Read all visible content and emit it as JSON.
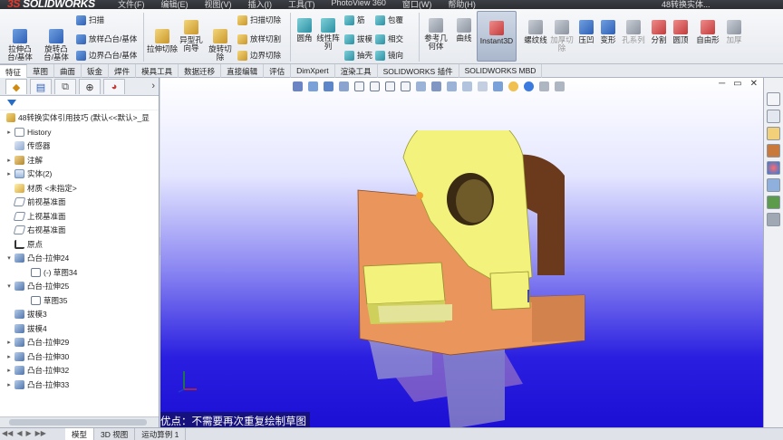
{
  "app": {
    "logo_prefix": "3S",
    "logo_text": "SOLIDWORKS",
    "menus": [
      "文件(F)",
      "编辑(E)",
      "视图(V)",
      "插入(I)",
      "工具(T)",
      "PhotoView 360",
      "窗口(W)",
      "帮助(H)"
    ],
    "document_title": "48转换实体..."
  },
  "ribbon": {
    "extrude_boss": "拉伸凸台/基体",
    "revolve_boss": "旋转凸台/基体",
    "sweep": "扫描",
    "loft": "放样凸台/基体",
    "boundary_boss": "边界凸台/基体",
    "extruded_cut": "拉伸切除",
    "hole_wizard": "异型孔向导",
    "revolved_cut": "旋转切除",
    "swept_cut": "扫描切除",
    "lofted_cut": "放样切割",
    "boundary_cut": "边界切除",
    "fillet": "圆角",
    "linear_pattern": "线性阵列",
    "rib": "筋",
    "draft": "拔模",
    "shell": "抽壳",
    "wrap": "包覆",
    "intersect": "相交",
    "mirror": "镜向",
    "ref_geometry": "参考几何体",
    "curves": "曲线",
    "instant3d": "Instant3D",
    "thread": "螺纹线",
    "thicken_cut": "加厚切除",
    "indent": "压凹",
    "flex": "变形",
    "dome": "圆顶",
    "split": "分割",
    "freeform": "自由形",
    "thicken": "加厚",
    "shape": "孔系列"
  },
  "command_tabs": [
    "特征",
    "草图",
    "曲面",
    "钣金",
    "焊件",
    "模具工具",
    "数据迁移",
    "直接编辑",
    "评估",
    "DimXpert",
    "渲染工具",
    "SOLIDWORKS 插件",
    "SOLIDWORKS MBD"
  ],
  "feature_tree": {
    "root": "48转换实体引用技巧 (默认<<默认>_显",
    "items": [
      {
        "label": "History",
        "icon": "history-icon",
        "expand": "▸",
        "depth": 0
      },
      {
        "label": "传感器",
        "icon": "sensor-icon",
        "expand": "",
        "depth": 0
      },
      {
        "label": "注解",
        "icon": "annotations-icon",
        "expand": "▸",
        "depth": 0
      },
      {
        "label": "实体(2)",
        "icon": "solid-bodies-icon",
        "expand": "▸",
        "depth": 0
      },
      {
        "label": "材质 <未指定>",
        "icon": "material-icon",
        "expand": "",
        "depth": 0
      },
      {
        "label": "前视基准面",
        "icon": "plane-icon",
        "expand": "",
        "depth": 0
      },
      {
        "label": "上视基准面",
        "icon": "plane-icon",
        "expand": "",
        "depth": 0
      },
      {
        "label": "右视基准面",
        "icon": "plane-icon",
        "expand": "",
        "depth": 0
      },
      {
        "label": "原点",
        "icon": "origin-icon",
        "expand": "",
        "depth": 0
      },
      {
        "label": "凸台-拉伸24",
        "icon": "extrude-feature-icon",
        "expand": "▾",
        "depth": 0
      },
      {
        "label": "(-) 草图34",
        "icon": "sketch-icon",
        "expand": "",
        "depth": 1
      },
      {
        "label": "凸台-拉伸25",
        "icon": "extrude-feature-icon",
        "expand": "▾",
        "depth": 0
      },
      {
        "label": "草图35",
        "icon": "sketch-icon",
        "expand": "",
        "depth": 1
      },
      {
        "label": "拔模3",
        "icon": "draft-feature-icon",
        "expand": "",
        "depth": 0
      },
      {
        "label": "拔模4",
        "icon": "draft-feature-icon",
        "expand": "",
        "depth": 0
      },
      {
        "label": "凸台-拉伸29",
        "icon": "extrude-feature-icon",
        "expand": "▸",
        "depth": 0
      },
      {
        "label": "凸台-拉伸30",
        "icon": "extrude-feature-icon",
        "expand": "▸",
        "depth": 0
      },
      {
        "label": "凸台-拉伸32",
        "icon": "extrude-feature-icon",
        "expand": "▸",
        "depth": 0
      },
      {
        "label": "凸台-拉伸33",
        "icon": "extrude-feature-icon",
        "expand": "▸",
        "depth": 0
      }
    ]
  },
  "viewport": {
    "caption": "优点：不需要再次重复绘制草图",
    "model_colors": {
      "yellow": "#f2f27c",
      "orange": "#e9955c",
      "dark": "#6b3a1c"
    }
  },
  "bottom_tabs": [
    "模型",
    "3D 视图",
    "运动算例 1"
  ],
  "window_controls": [
    "─",
    "▭",
    "✕"
  ]
}
